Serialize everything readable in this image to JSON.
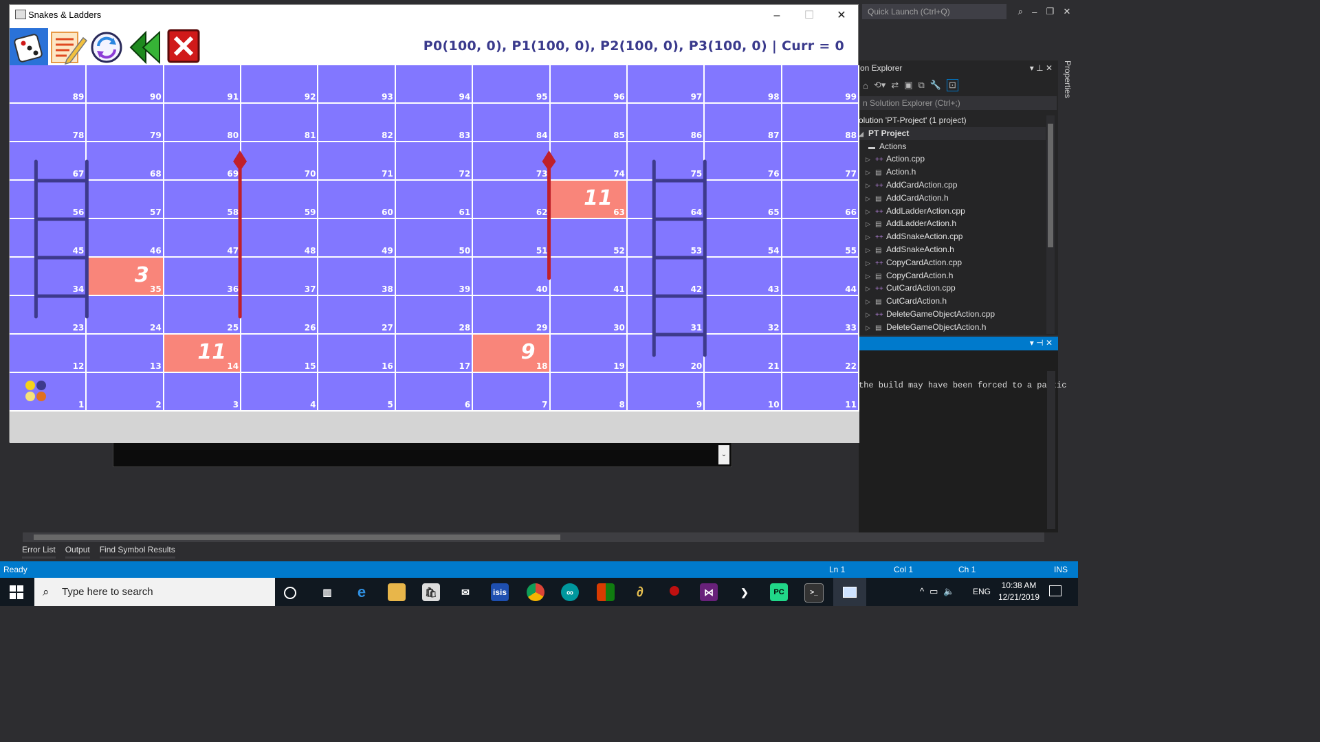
{
  "vs": {
    "quick_launch": "Quick Launch (Ctrl+Q)",
    "solution_explorer": {
      "title": "on Explorer",
      "search_placeholder": "n Solution Explorer (Ctrl+;)",
      "solution_label": "olution 'PT-Project' (1 project)",
      "project_label": "PT Project",
      "folder_label": "Actions",
      "files": [
        {
          "name": "Action.cpp",
          "type": "cpp"
        },
        {
          "name": "Action.h",
          "type": "h"
        },
        {
          "name": "AddCardAction.cpp",
          "type": "cpp"
        },
        {
          "name": "AddCardAction.h",
          "type": "h"
        },
        {
          "name": "AddLadderAction.cpp",
          "type": "cpp"
        },
        {
          "name": "AddLadderAction.h",
          "type": "h"
        },
        {
          "name": "AddSnakeAction.cpp",
          "type": "cpp"
        },
        {
          "name": "AddSnakeAction.h",
          "type": "h"
        },
        {
          "name": "CopyCardAction.cpp",
          "type": "cpp"
        },
        {
          "name": "CopyCardAction.h",
          "type": "h"
        },
        {
          "name": "CutCardAction.cpp",
          "type": "cpp"
        },
        {
          "name": "CutCardAction.h",
          "type": "h"
        },
        {
          "name": "DeleteGameObjectAction.cpp",
          "type": "cpp"
        },
        {
          "name": "DeleteGameObjectAction.h",
          "type": "h"
        }
      ]
    },
    "properties_tab": "Properties",
    "output_text": "the build may have been forced to a partic",
    "bottom_tabs": [
      "Error List",
      "Output",
      "Find Symbol Results"
    ],
    "status": {
      "ready": "Ready",
      "ln": "Ln 1",
      "col": "Col 1",
      "ch": "Ch 1",
      "ins": "INS"
    }
  },
  "taskbar": {
    "search_placeholder": "Type here to search",
    "lang": "ENG",
    "time": "10:38 AM",
    "date": "12/21/2019"
  },
  "game": {
    "title": "Snakes & Ladders",
    "status": "P0(100, 0), P1(100, 0), P2(100, 0), P3(100, 0) | Curr = 0",
    "tools": [
      {
        "name": "dice-tool-icon"
      },
      {
        "name": "edit-mode-icon"
      },
      {
        "name": "restart-icon"
      },
      {
        "name": "back-icon"
      },
      {
        "name": "exit-icon"
      }
    ],
    "rows": [
      [
        89,
        90,
        91,
        92,
        93,
        94,
        95,
        96,
        97,
        98,
        99
      ],
      [
        78,
        79,
        80,
        81,
        82,
        83,
        84,
        85,
        86,
        87,
        88
      ],
      [
        67,
        68,
        69,
        70,
        71,
        72,
        73,
        74,
        75,
        76,
        77
      ],
      [
        56,
        57,
        58,
        59,
        60,
        61,
        62,
        63,
        64,
        65,
        66
      ],
      [
        45,
        46,
        47,
        48,
        49,
        50,
        51,
        52,
        53,
        54,
        55
      ],
      [
        34,
        35,
        36,
        37,
        38,
        39,
        40,
        41,
        42,
        43,
        44
      ],
      [
        23,
        24,
        25,
        26,
        27,
        28,
        29,
        30,
        31,
        32,
        33
      ],
      [
        12,
        13,
        14,
        15,
        16,
        17,
        18,
        19,
        20,
        21,
        22
      ],
      [
        1,
        2,
        3,
        4,
        5,
        6,
        7,
        8,
        9,
        10,
        11
      ]
    ],
    "cards": [
      {
        "cell": 35,
        "label": "3"
      },
      {
        "cell": 63,
        "label": "11"
      },
      {
        "cell": 14,
        "label": "11"
      },
      {
        "cell": 18,
        "label": "9"
      }
    ],
    "ladders": [
      {
        "from": 24,
        "to": 68
      },
      {
        "from": 21,
        "to": 76
      }
    ],
    "snakes": [
      {
        "head": 69,
        "tail": 25
      },
      {
        "head": 73,
        "tail": 40
      }
    ],
    "players": [
      {
        "id": "P0",
        "color": "#f5d21a"
      },
      {
        "id": "P1",
        "color": "#3d3a8c"
      },
      {
        "id": "P2",
        "color": "#f5e27a"
      },
      {
        "id": "P3",
        "color": "#e07020"
      }
    ],
    "colors": {
      "board": "#8277ff",
      "card": "#f9857a",
      "snake": "#c0202a",
      "ladder": "#3d3a8c"
    }
  }
}
